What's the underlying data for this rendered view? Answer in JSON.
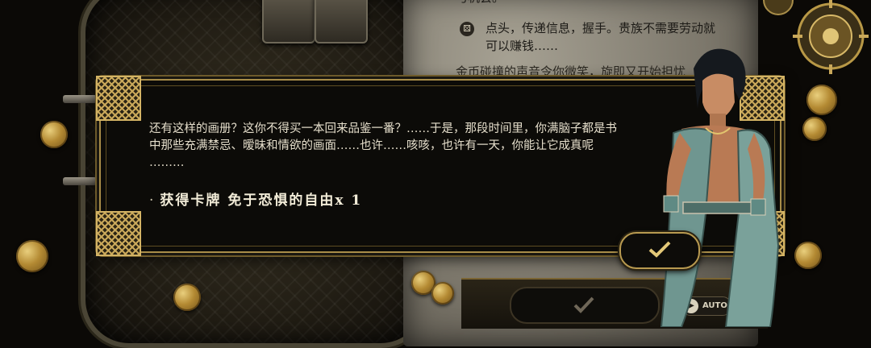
{
  "parchment": {
    "line_top": "与机会。",
    "option_text_line1": "点头，传递信息，握手。贵族不需要劳动就",
    "option_text_line2": "可以赚钱……",
    "line_partial": "金币碰撞的声音令你微笑，旋即又开始担忧"
  },
  "dialog": {
    "body_lines": [
      "还有这样的画册？这你不得买一本回来品鉴一番？……于是，那段时间里，你满脑子都是书",
      "中那些充满禁忌、暧昧和情欲的画面……也许……咳咳，也许有一天，你能让它成真呢",
      "………"
    ],
    "reward_bullet": "·",
    "reward_text": "获得卡牌 免于恐惧的自由x 1"
  },
  "controls": {
    "auto_label": "AUTO",
    "auto_icon": "▶",
    "dice_icon": "⚄"
  },
  "colors": {
    "gold_border": "#a88d49",
    "dialog_bg": "#0c0b08",
    "text": "#e6dfcc"
  }
}
